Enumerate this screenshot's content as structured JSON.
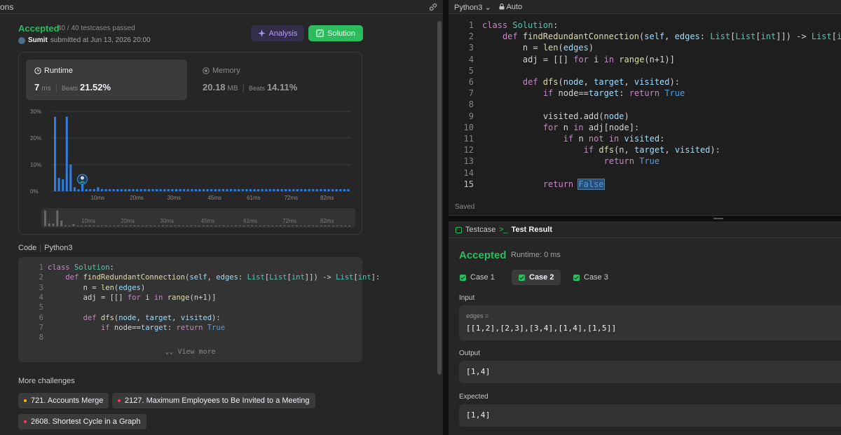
{
  "left_tab": {
    "label": "ons"
  },
  "submission": {
    "status": "Accepted",
    "passed": "40 / 40 testcases passed",
    "user": "Sumit",
    "submitted_at": "submitted at Jun 13, 2026 20:00",
    "analysis_label": "Analysis",
    "solution_label": "Solution"
  },
  "runtime": {
    "title": "Runtime",
    "value": "7",
    "unit": "ms",
    "beats_label": "Beats",
    "beats": "21.52%"
  },
  "memory": {
    "title": "Memory",
    "value": "20.18",
    "unit": "MB",
    "beats_label": "Beats",
    "beats": "14.11%"
  },
  "chart_data": {
    "type": "bar",
    "yticks": [
      "30%",
      "20%",
      "10%",
      "0%"
    ],
    "ylim": [
      0,
      30
    ],
    "xticks": [
      "10ms",
      "20ms",
      "30ms",
      "45ms",
      "61ms",
      "72ms",
      "82ms"
    ],
    "values": [
      28,
      5,
      4.5,
      28,
      10,
      1.5,
      0.8,
      4,
      0.8,
      0.8,
      0.8,
      1.5,
      0.8,
      0.8,
      0.8,
      0.8,
      0.8,
      0.8,
      0.8,
      0.8,
      0.8,
      0.8,
      0.8,
      0.8,
      0.8,
      0.8,
      0.8,
      0.8,
      0.8,
      0.8,
      0.8,
      0.8,
      0.8,
      0.8,
      0.8,
      0.8,
      0.8,
      0.8,
      0.8,
      0.8,
      0.8,
      0.8,
      0.8,
      0.8,
      0.8,
      0.8,
      0.8,
      0.8,
      0.8,
      0.8,
      0.8,
      0.8,
      0.8,
      0.8,
      0.8,
      0.8,
      0.8,
      0.8,
      0.8,
      0.8,
      0.8,
      0.8,
      0.8,
      0.8,
      0.8,
      0.8,
      0.8,
      0.8,
      0.8,
      0.8,
      0.8,
      0.8,
      0.8,
      0.8,
      0.8,
      0.8
    ],
    "highlight_index": 6,
    "bar_color": "#2f7de1",
    "grid": true
  },
  "code_section": {
    "title": "Code",
    "lang": "Python3",
    "view_more": "View more",
    "lines": [
      {
        "n": "1",
        "t": "class Solution:"
      },
      {
        "n": "2",
        "t": "    def findRedundantConnection(self, edges: List[List[int]]) -> List[int]:"
      },
      {
        "n": "3",
        "t": "        n = len(edges)"
      },
      {
        "n": "4",
        "t": "        adj = [[] for i in range(n+1)]"
      },
      {
        "n": "5",
        "t": ""
      },
      {
        "n": "6",
        "t": "        def dfs(node, target, visited):"
      },
      {
        "n": "7",
        "t": "            if node==target: return True"
      },
      {
        "n": "8",
        "t": ""
      }
    ]
  },
  "more_challenges": {
    "title": "More challenges",
    "items": [
      {
        "label": "721. Accounts Merge",
        "dot": "#ffb800"
      },
      {
        "label": "2127. Maximum Employees to Be Invited to a Meeting",
        "dot": "#ff375f"
      },
      {
        "label": "2608. Shortest Cycle in a Graph",
        "dot": "#ff375f"
      }
    ]
  },
  "editor": {
    "lang": "Python3",
    "mode": "Auto",
    "saved": "Saved",
    "lines": [
      {
        "n": "1",
        "t": "class Solution:"
      },
      {
        "n": "2",
        "t": "    def findRedundantConnection(self, edges: List[List[int]]) -> List[int]:"
      },
      {
        "n": "3",
        "t": "        n = len(edges)"
      },
      {
        "n": "4",
        "t": "        adj = [[] for i in range(n+1)]"
      },
      {
        "n": "5",
        "t": ""
      },
      {
        "n": "6",
        "t": "        def dfs(node, target, visited):"
      },
      {
        "n": "7",
        "t": "            if node==target: return True"
      },
      {
        "n": "8",
        "t": ""
      },
      {
        "n": "9",
        "t": "            visited.add(node)"
      },
      {
        "n": "10",
        "t": "            for n in adj[node]:"
      },
      {
        "n": "11",
        "t": "                if n not in visited:"
      },
      {
        "n": "12",
        "t": "                    if dfs(n, target, visited):"
      },
      {
        "n": "13",
        "t": "                        return True"
      },
      {
        "n": "14",
        "t": ""
      },
      {
        "n": "15",
        "t": "            return False"
      }
    ]
  },
  "testpanel": {
    "tab_testcase": "Testcase",
    "tab_result": "Test Result",
    "status": "Accepted",
    "runtime": "Runtime: 0 ms",
    "cases": [
      "Case 1",
      "Case 2",
      "Case 3"
    ],
    "input_label": "Input",
    "input_var": "edges =",
    "input_value": "[[1,2],[2,3],[3,4],[1,4],[1,5]]",
    "output_label": "Output",
    "output_value": "[1,4]",
    "expected_label": "Expected",
    "expected_value": "[1,4]"
  }
}
